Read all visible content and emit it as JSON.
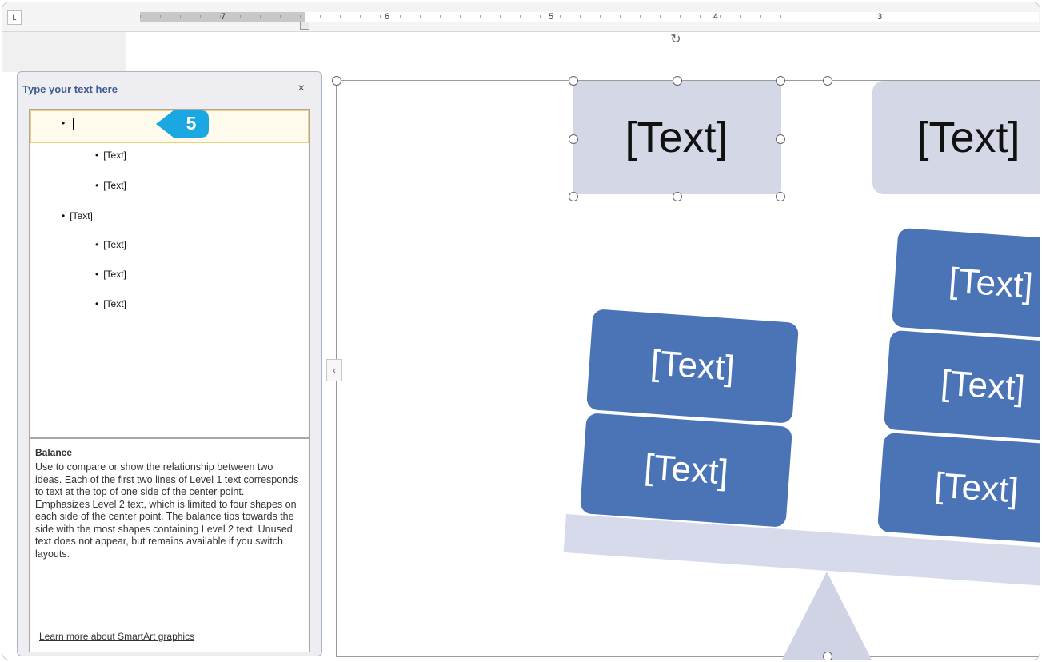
{
  "ruler": {
    "corner": "L",
    "numbers": [
      "7",
      "6",
      "5",
      "4",
      "3"
    ]
  },
  "text_pane": {
    "title": "Type your text here",
    "close": "×",
    "bullets": [
      {
        "level": 1,
        "text": ""
      },
      {
        "level": 2,
        "text": "[Text]"
      },
      {
        "level": 2,
        "text": "[Text]"
      },
      {
        "level": 1,
        "text": "[Text]"
      },
      {
        "level": 2,
        "text": "[Text]"
      },
      {
        "level": 2,
        "text": "[Text]"
      },
      {
        "level": 2,
        "text": "[Text]"
      }
    ],
    "description": {
      "title": "Balance",
      "text": "Use to compare or show the relationship between two ideas. Each of the first two lines of Level 1 text corresponds to text at the top of one side of the center point. Emphasizes Level 2 text, which is limited to four shapes on each side of the center point. The balance tips towards the side with the most shapes containing Level 2 text. Unused text does not appear, but remains available if you switch layouts.",
      "link": "Learn more about SmartArt graphics"
    }
  },
  "step_badge": {
    "number": "5",
    "color": "#1aa7e2"
  },
  "collapse_arrow": "‹",
  "canvas": {
    "rotate_icon": "rotate-icon",
    "shapes": [
      {
        "text": "[Text]"
      },
      {
        "text": "[Text]"
      },
      {
        "text": "[Text]"
      },
      {
        "text": "[Text]"
      },
      {
        "text": "[Text]"
      },
      {
        "text": "[Text]"
      },
      {
        "text": "[Text]"
      }
    ]
  },
  "colors": {
    "header_shape": "#d3d7e6",
    "child_shape": "#4b74b6",
    "fulcrum": "#cfd3e4",
    "badge": "#1aa7e2",
    "pane_title": "#3b5b8d"
  }
}
